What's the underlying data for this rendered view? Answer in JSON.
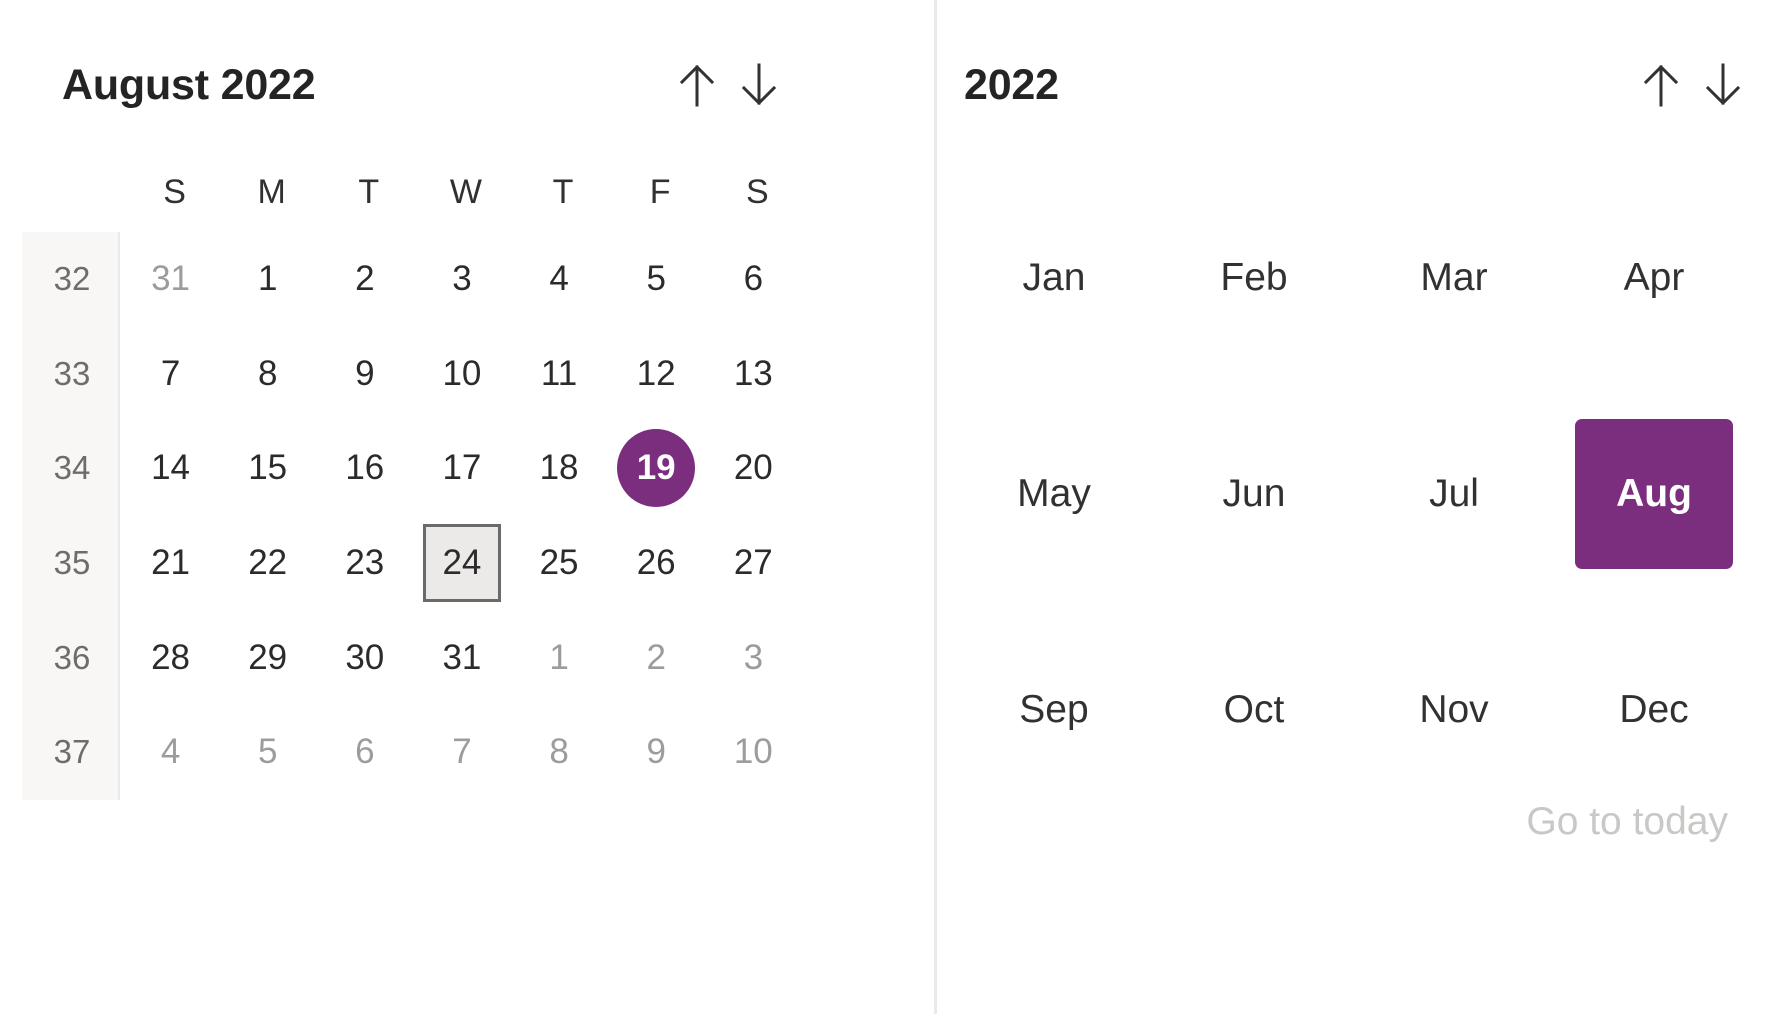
{
  "colors": {
    "accent": "#7b2d7e",
    "text": "#323130",
    "text_muted": "#9d9c9a",
    "weeknum_text": "#6e6d6b",
    "weeknum_band": "#f8f7f5",
    "focus_border": "#6b6a68",
    "focus_fill": "#eceae9",
    "divider": "#eae9e7",
    "disabled_link": "#c9c8c6"
  },
  "day_picker": {
    "title": "August 2022",
    "prev_label": "↑",
    "next_label": "↓",
    "weekdays": [
      "S",
      "M",
      "T",
      "W",
      "T",
      "F",
      "S"
    ],
    "weeks": [
      {
        "week_number": "32",
        "days": [
          {
            "label": "31",
            "outside": true
          },
          {
            "label": "1",
            "outside": false
          },
          {
            "label": "2",
            "outside": false
          },
          {
            "label": "3",
            "outside": false
          },
          {
            "label": "4",
            "outside": false
          },
          {
            "label": "5",
            "outside": false
          },
          {
            "label": "6",
            "outside": false
          }
        ]
      },
      {
        "week_number": "33",
        "days": [
          {
            "label": "7",
            "outside": false
          },
          {
            "label": "8",
            "outside": false
          },
          {
            "label": "9",
            "outside": false
          },
          {
            "label": "10",
            "outside": false
          },
          {
            "label": "11",
            "outside": false
          },
          {
            "label": "12",
            "outside": false
          },
          {
            "label": "13",
            "outside": false
          }
        ]
      },
      {
        "week_number": "34",
        "days": [
          {
            "label": "14",
            "outside": false
          },
          {
            "label": "15",
            "outside": false
          },
          {
            "label": "16",
            "outside": false
          },
          {
            "label": "17",
            "outside": false
          },
          {
            "label": "18",
            "outside": false
          },
          {
            "label": "19",
            "outside": false,
            "selected": true
          },
          {
            "label": "20",
            "outside": false
          }
        ]
      },
      {
        "week_number": "35",
        "days": [
          {
            "label": "21",
            "outside": false
          },
          {
            "label": "22",
            "outside": false
          },
          {
            "label": "23",
            "outside": false
          },
          {
            "label": "24",
            "outside": false,
            "focused": true
          },
          {
            "label": "25",
            "outside": false
          },
          {
            "label": "26",
            "outside": false
          },
          {
            "label": "27",
            "outside": false
          }
        ]
      },
      {
        "week_number": "36",
        "days": [
          {
            "label": "28",
            "outside": false
          },
          {
            "label": "29",
            "outside": false
          },
          {
            "label": "30",
            "outside": false
          },
          {
            "label": "31",
            "outside": false
          },
          {
            "label": "1",
            "outside": true
          },
          {
            "label": "2",
            "outside": true
          },
          {
            "label": "3",
            "outside": true
          }
        ]
      },
      {
        "week_number": "37",
        "days": [
          {
            "label": "4",
            "outside": true
          },
          {
            "label": "5",
            "outside": true
          },
          {
            "label": "6",
            "outside": true
          },
          {
            "label": "7",
            "outside": true
          },
          {
            "label": "8",
            "outside": true
          },
          {
            "label": "9",
            "outside": true
          },
          {
            "label": "10",
            "outside": true
          }
        ]
      }
    ]
  },
  "month_picker": {
    "title": "2022",
    "prev_label": "↑",
    "next_label": "↓",
    "months": [
      [
        {
          "label": "Jan",
          "selected": false
        },
        {
          "label": "Feb",
          "selected": false
        },
        {
          "label": "Mar",
          "selected": false
        },
        {
          "label": "Apr",
          "selected": false
        }
      ],
      [
        {
          "label": "May",
          "selected": false
        },
        {
          "label": "Jun",
          "selected": false
        },
        {
          "label": "Jul",
          "selected": false
        },
        {
          "label": "Aug",
          "selected": true
        }
      ],
      [
        {
          "label": "Sep",
          "selected": false
        },
        {
          "label": "Oct",
          "selected": false
        },
        {
          "label": "Nov",
          "selected": false
        },
        {
          "label": "Dec",
          "selected": false
        }
      ]
    ],
    "go_to_today": "Go to today"
  },
  "icons": {
    "prev": "arrow-up-icon",
    "next": "arrow-down-icon"
  }
}
